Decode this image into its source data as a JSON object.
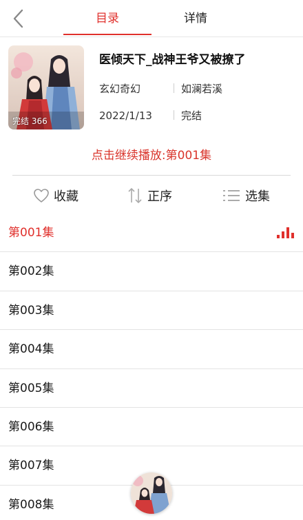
{
  "header": {
    "tabs": [
      {
        "label": "目录",
        "active": true
      },
      {
        "label": "详情",
        "active": false
      }
    ]
  },
  "book": {
    "title": "医倾天下_战神王爷又被撩了",
    "genre": "玄幻奇幻",
    "author": "如澜若溪",
    "date": "2022/1/13",
    "status": "完结",
    "cover_badge": "完结 366"
  },
  "continue_play": "点击继续播放:第001集",
  "actions": {
    "favorite": "收藏",
    "order": "正序",
    "select": "选集"
  },
  "episodes": [
    {
      "label": "第001集",
      "active": true
    },
    {
      "label": "第002集",
      "active": false
    },
    {
      "label": "第003集",
      "active": false
    },
    {
      "label": "第004集",
      "active": false
    },
    {
      "label": "第005集",
      "active": false
    },
    {
      "label": "第006集",
      "active": false
    },
    {
      "label": "第007集",
      "active": false
    },
    {
      "label": "第008集",
      "active": false
    }
  ],
  "icons": {
    "back": "chevron-left-icon",
    "favorite": "heart-icon",
    "order": "sort-arrows-icon",
    "select": "list-icon",
    "playing": "equalizer-icon"
  },
  "colors": {
    "accent": "#e0302c"
  }
}
